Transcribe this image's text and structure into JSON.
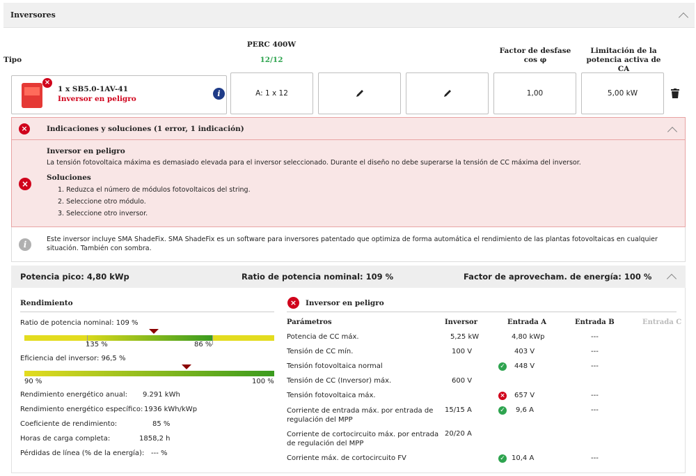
{
  "header": {
    "title": "Inversores"
  },
  "columns": {
    "tipo": "Tipo",
    "module": "PERC 400W",
    "module_count": "12/12",
    "factor": "Factor de desfase cos φ",
    "limit": "Limitación de la potencia activa de CA"
  },
  "inverter": {
    "name": "1 x SB5.0-1AV-41",
    "status": "Inversor en peligro",
    "string_a": "A: 1 x 12",
    "cos_phi": "1,00",
    "power_limit": "5,00 kW"
  },
  "errors": {
    "title": "Indicaciones y soluciones (1 error, 1 indicación)",
    "error_title": "Inversor en peligro",
    "error_text": "La tensión fotovoltaica máxima es demasiado elevada para el inversor seleccionado. Durante el diseño no debe superarse la tensión de CC máxima del inversor.",
    "solutions_title": "Soluciones",
    "solutions": [
      "1. Reduzca el número de módulos fotovoltaicos del string.",
      "2. Seleccione otro módulo.",
      "3. Seleccione otro inversor."
    ],
    "info_text": "Este inversor incluye SMA ShadeFix. SMA ShadeFix es un software para inversores patentado que optimiza de forma automática el rendimiento de las plantas fotovoltaicas en cualquier situación. También con sombra."
  },
  "summary": {
    "peak": "Potencia pico: 4,80 kWp",
    "ratio": "Ratio de potencia nominal: 109 %",
    "factor": "Factor de aprovecham. de energía: 100 %"
  },
  "yield": {
    "title": "Rendimiento",
    "ratio_label": "Ratio de potencia nominal: 109 %",
    "ratio_left": "135 %",
    "ratio_right": "86 %",
    "ratio_value": 109,
    "eff_label": "Eficiencia del inversor: 96,5 %",
    "eff_left": "90 %",
    "eff_right": "100 %",
    "eff_value": 96.5,
    "rows": [
      {
        "label": "Rendimiento energético anual:",
        "value": "9.291 kWh"
      },
      {
        "label": "Rendimiento energético específico:",
        "value": "1936 kWh/kWp"
      },
      {
        "label": "Coeficiente de rendimiento:",
        "value": "85 %"
      },
      {
        "label": "Horas de carga completa:",
        "value": "1858,2 h"
      },
      {
        "label": "Pérdidas de línea (% de la energía):",
        "value": "--- %"
      }
    ]
  },
  "params": {
    "title": "Inversor en peligro",
    "headers": [
      "Parámetros",
      "Inversor",
      "Entrada A",
      "Entrada B",
      "Entrada C"
    ],
    "rows": [
      {
        "name": "Potencia de CC máx.",
        "inv": "5,25 kW",
        "a": "4,80 kWp",
        "b": "---",
        "status": ""
      },
      {
        "name": "Tensión de CC mín.",
        "inv": "100 V",
        "a": "403 V",
        "b": "---",
        "status": ""
      },
      {
        "name": "Tensión fotovoltaica normal",
        "inv": "",
        "a": "448 V",
        "b": "---",
        "status": "ok"
      },
      {
        "name": "Tensión de CC (Inversor) máx.",
        "inv": "600 V",
        "a": "",
        "b": "",
        "status": ""
      },
      {
        "name": "Tensión fotovoltaica máx.",
        "inv": "",
        "a": "657 V",
        "b": "---",
        "status": "err"
      },
      {
        "name": "Corriente de entrada máx. por entrada de regulación del MPP",
        "inv": "15/15 A",
        "a": "9,6 A",
        "b": "---",
        "status": "ok"
      },
      {
        "name": "Corriente de cortocircuito máx. por entrada de regulación del MPP",
        "inv": "20/20 A",
        "a": "",
        "b": "",
        "status": ""
      },
      {
        "name": "Corriente máx. de cortocircuito FV",
        "inv": "",
        "a": "10,4 A",
        "b": "---",
        "status": "ok"
      }
    ]
  }
}
